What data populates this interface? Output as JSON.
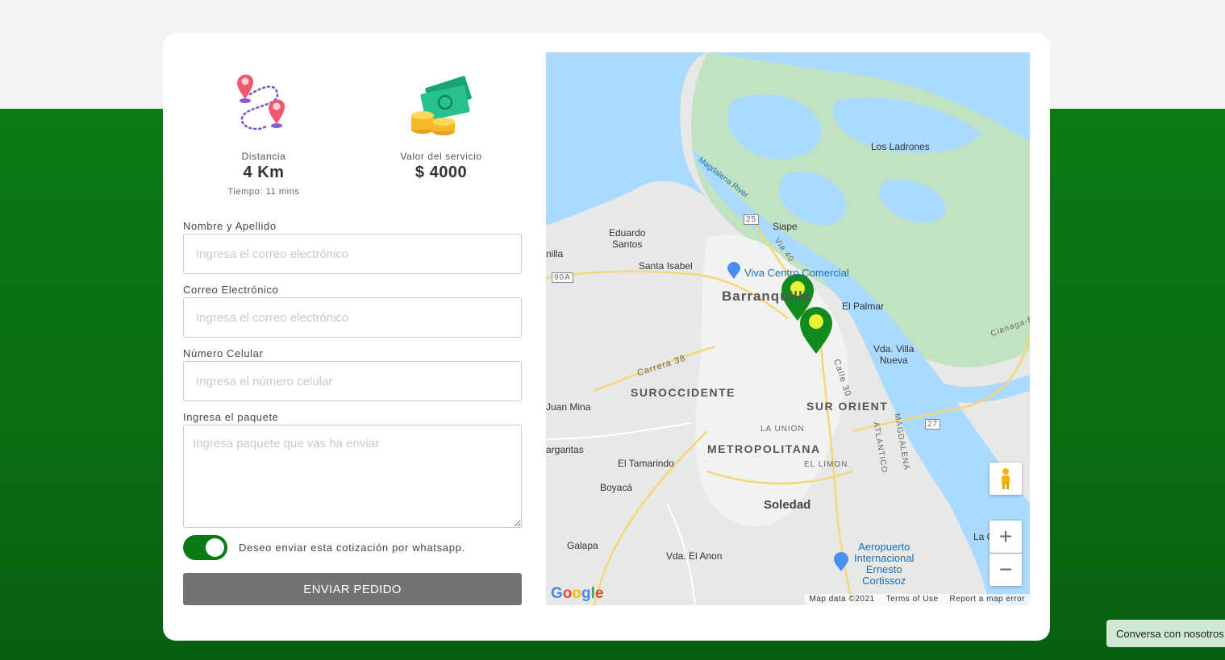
{
  "stats": {
    "distance_label": "Distancia",
    "distance_value": "4 Km",
    "time_text": "Tiempo: 11 mins",
    "price_label": "Valor del servicio",
    "price_value": "$ 4000"
  },
  "form": {
    "name_label": "Nombre y Apellido",
    "name_placeholder": "Ingresa el correo electrónico",
    "email_label": "Correo Electrónico",
    "email_placeholder": "Ingresa el correo electrónico",
    "phone_label": "Número Celular",
    "phone_placeholder": "Ingresa el número celular",
    "package_label": "Ingresa el paquete",
    "package_placeholder": "Ingresa paquete que vas ha enviar",
    "whatsapp_toggle_label": "Deseo enviar esta cotización por whatsapp.",
    "whatsapp_toggle_on": true,
    "submit_label": "ENVIAR PEDIDO"
  },
  "map": {
    "labels": {
      "los_ladrones": "Los Ladrones",
      "magdalena_river": "Magdalena River",
      "siape": "Siape",
      "eduardo_santos": "Eduardo\nSantos",
      "santa_isabel": "Santa Isabel",
      "nilla": "nilla",
      "viva_centro": "Viva Centro Comercial",
      "barranquilla": "Barranquilla",
      "el_palmar": "El Palmar",
      "vda_villa_nueva": "Vda. Villa\nNueva",
      "carrera_38": "Carrera 38",
      "calle_30": "Calle 30",
      "suroccidente": "SUROCCIDENTE",
      "sur_orient": "SUR ORIENT",
      "juan_mina": "Juan Mina",
      "la_union": "LA UNION",
      "metropolitana": "METROPOLITANA",
      "atlantico": "ATLANTICO",
      "magdalena": "MAGDALENA",
      "margaritas": "argaritas",
      "el_tamarindo": "El Tamarindo",
      "el_limon": "EL LIMON",
      "boyaca": "Boyacá",
      "soledad": "Soledad",
      "galapa": "Galapa",
      "vda_el_anon": "Vda. El Anon",
      "aeropuerto": "Aeropuerto\nInternacional\nErnesto\nCortissoz",
      "cienaga": "Cienaga-Bar",
      "la_c": "La C",
      "via_40": "Via 40",
      "route_25": "25",
      "route_90a": "90A",
      "route_27": "27"
    },
    "footer": {
      "data": "Map data ©2021",
      "terms": "Terms of Use",
      "report": "Report a map error"
    },
    "logo": "Google",
    "zoom_in": "+",
    "zoom_out": "−"
  },
  "chat": {
    "label": "Conversa con nosotros"
  },
  "colors": {
    "brand_green": "#0a7a15",
    "submit_gray": "#737373",
    "water": "#aadaff",
    "park": "#c1e3c4"
  },
  "icons": [
    "route-pins-icon",
    "money-coins-icon",
    "courier-pin-icon",
    "pegman-icon",
    "place-icon",
    "airport-icon"
  ]
}
